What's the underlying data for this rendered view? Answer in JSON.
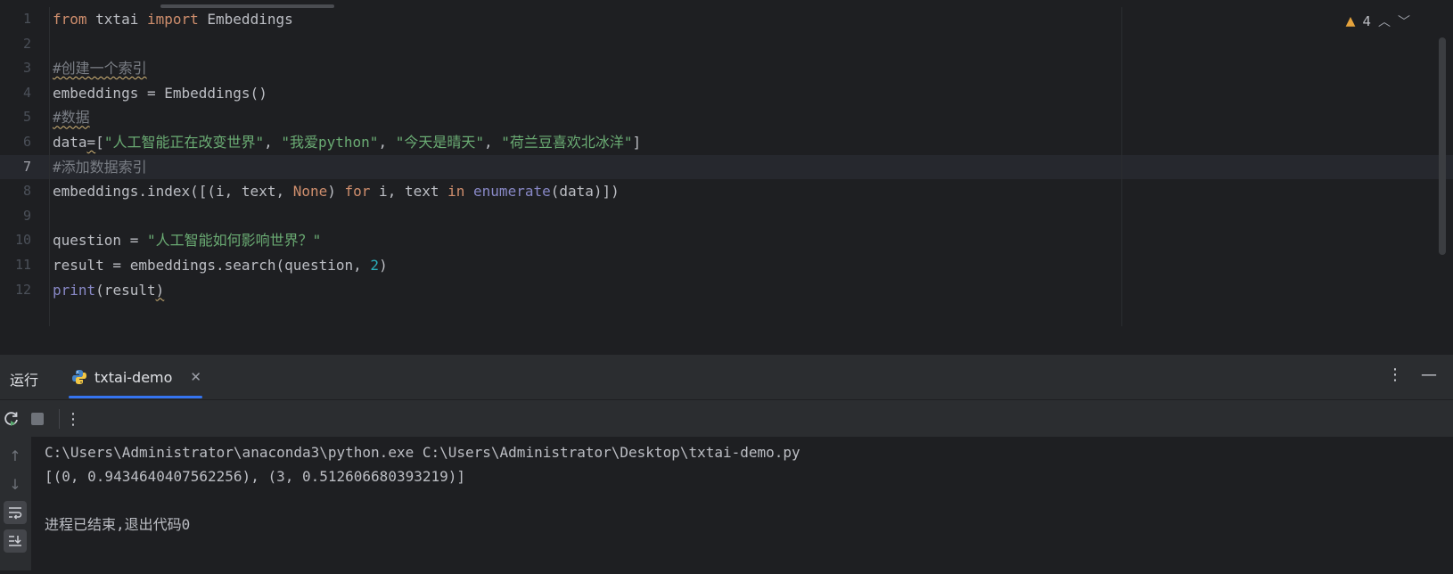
{
  "editor": {
    "line_numbers": [
      "1",
      "2",
      "3",
      "4",
      "5",
      "6",
      "7",
      "8",
      "9",
      "10",
      "11",
      "12"
    ],
    "active_line": "7",
    "lines": [
      [
        {
          "t": "from",
          "c": "kw"
        },
        {
          "t": " txtai ",
          "c": "plain"
        },
        {
          "t": "import",
          "c": "kw"
        },
        {
          "t": " Embeddings",
          "c": "plain"
        }
      ],
      [],
      [
        {
          "t": "#创建一个索引",
          "c": "cmt squig"
        }
      ],
      [
        {
          "t": "embeddings = Embeddings()",
          "c": "plain"
        }
      ],
      [
        {
          "t": "#数据",
          "c": "cmt squig"
        }
      ],
      [
        {
          "t": "data",
          "c": "plain"
        },
        {
          "t": "=",
          "c": "plain squig"
        },
        {
          "t": "[",
          "c": "plain"
        },
        {
          "t": "\"人工智能正在改变世界\"",
          "c": "str"
        },
        {
          "t": ", ",
          "c": "plain"
        },
        {
          "t": "\"我爱python\"",
          "c": "str"
        },
        {
          "t": ", ",
          "c": "plain"
        },
        {
          "t": "\"今天是晴天\"",
          "c": "str"
        },
        {
          "t": ", ",
          "c": "plain"
        },
        {
          "t": "\"荷兰豆喜欢北冰洋\"",
          "c": "str"
        },
        {
          "t": "]",
          "c": "plain"
        }
      ],
      [
        {
          "t": "#添加数据索引",
          "c": "cmt"
        }
      ],
      [
        {
          "t": "embeddings.index([(i, text, ",
          "c": "plain"
        },
        {
          "t": "None",
          "c": "kw"
        },
        {
          "t": ") ",
          "c": "plain"
        },
        {
          "t": "for",
          "c": "kw"
        },
        {
          "t": " i, text ",
          "c": "plain"
        },
        {
          "t": "in",
          "c": "kw"
        },
        {
          "t": " ",
          "c": "plain"
        },
        {
          "t": "enumerate",
          "c": "builtin"
        },
        {
          "t": "(data)])",
          "c": "plain"
        }
      ],
      [],
      [
        {
          "t": "question = ",
          "c": "plain"
        },
        {
          "t": "\"人工智能如何影响世界？\"",
          "c": "str"
        }
      ],
      [
        {
          "t": "result = embeddings.search(question, ",
          "c": "plain"
        },
        {
          "t": "2",
          "c": "num"
        },
        {
          "t": ")",
          "c": "plain"
        }
      ],
      [
        {
          "t": "print",
          "c": "builtin"
        },
        {
          "t": "(result",
          "c": "plain"
        },
        {
          "t": ")",
          "c": "plain squig"
        }
      ]
    ],
    "inspection": {
      "warning_count": "4",
      "warning_icon": "warning-triangle-icon"
    }
  },
  "run_panel": {
    "title": "运行",
    "tab_label": "txtai-demo",
    "tab_icon": "python-icon",
    "icons": {
      "rerun": "rerun-icon",
      "stop": "stop-icon",
      "more": "more-vertical-icon",
      "minimize": "minimize-icon",
      "up": "arrow-up-icon",
      "down": "arrow-down-icon",
      "soft_wrap": "soft-wrap-icon",
      "scroll_end": "scroll-to-end-icon"
    },
    "console_lines": [
      "C:\\Users\\Administrator\\anaconda3\\python.exe C:\\Users\\Administrator\\Desktop\\txtai-demo.py",
      "[(0, 0.9434640407562256), (3, 0.512606680393219)]",
      "",
      "进程已结束,退出代码0"
    ]
  },
  "colors": {
    "background": "#1e1f22",
    "panel": "#2b2d30",
    "accent": "#3574f0",
    "keyword": "#cf8e6d",
    "string": "#6aab73",
    "number": "#2aacb8",
    "builtin": "#8888c6",
    "comment": "#7a7e85",
    "warning": "#e5a33d"
  }
}
